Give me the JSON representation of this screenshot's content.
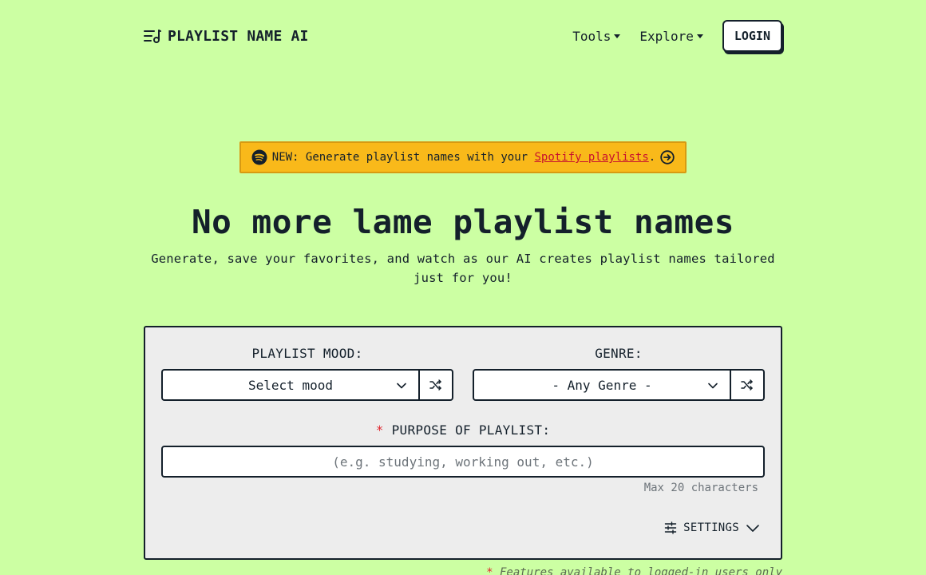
{
  "header": {
    "brand_name": "PLAYLIST NAME AI",
    "brand_icon": "playlist-icon",
    "nav": [
      {
        "label": "Tools"
      },
      {
        "label": "Explore"
      }
    ],
    "login_label": "LOGIN"
  },
  "banner": {
    "icon": "spotify-icon",
    "prefix": "NEW: Generate playlist names with your ",
    "link_text": "Spotify playlists",
    "suffix": ".",
    "arrow_icon": "arrow-right-circle-icon"
  },
  "hero": {
    "title": "No more lame playlist names",
    "subtitle": "Generate, save your favorites, and watch as our AI creates playlist names tailored just for you!"
  },
  "form": {
    "mood_label": "PLAYLIST MOOD:",
    "mood_value": "Select mood",
    "genre_label": "GENRE:",
    "genre_value": "- Any Genre -",
    "purpose_star": "*",
    "purpose_label": " PURPOSE OF PLAYLIST:",
    "purpose_placeholder": "(e.g. studying, working out, etc.)",
    "purpose_value": "",
    "max_chars": "Max 20 characters",
    "settings_label": "SETTINGS"
  },
  "footnote": {
    "star": "*",
    "text": " Features available to logged-in users only"
  },
  "colors": {
    "background": "#ccffa3",
    "banner": "#f9b91a",
    "link": "#c8102e",
    "required": "#e0262e",
    "text": "#14202b",
    "card": "#ededed"
  }
}
